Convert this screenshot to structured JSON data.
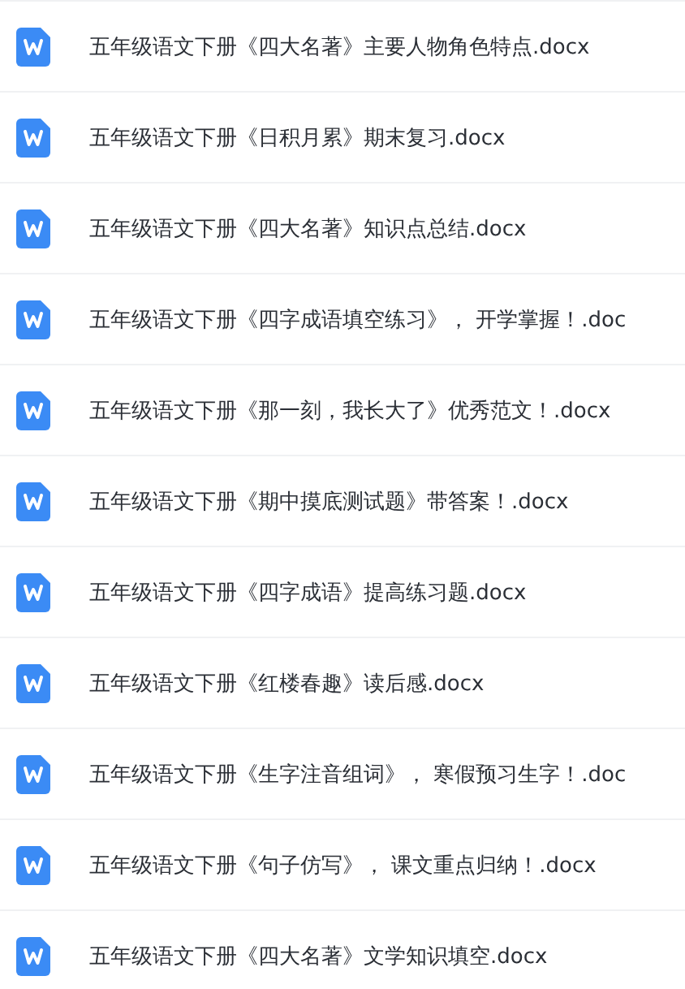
{
  "files": [
    {
      "name": "五年级语文下册《四大名著》主要人物角色特点.docx"
    },
    {
      "name": "五年级语文下册《日积月累》期末复习.docx"
    },
    {
      "name": "五年级语文下册《四大名著》知识点总结.docx"
    },
    {
      "name": "五年级语文下册《四字成语填空练习》， 开学掌握！.doc"
    },
    {
      "name": "五年级语文下册《那一刻，我长大了》优秀范文！.docx"
    },
    {
      "name": "五年级语文下册《期中摸底测试题》带答案！.docx"
    },
    {
      "name": "五年级语文下册《四字成语》提高练习题.docx"
    },
    {
      "name": "五年级语文下册《红楼春趣》读后感.docx"
    },
    {
      "name": "五年级语文下册《生字注音组词》， 寒假预习生字！.doc"
    },
    {
      "name": "五年级语文下册《句子仿写》， 课文重点归纳！.docx"
    },
    {
      "name": "五年级语文下册《四大名著》文学知识填空.docx"
    }
  ]
}
